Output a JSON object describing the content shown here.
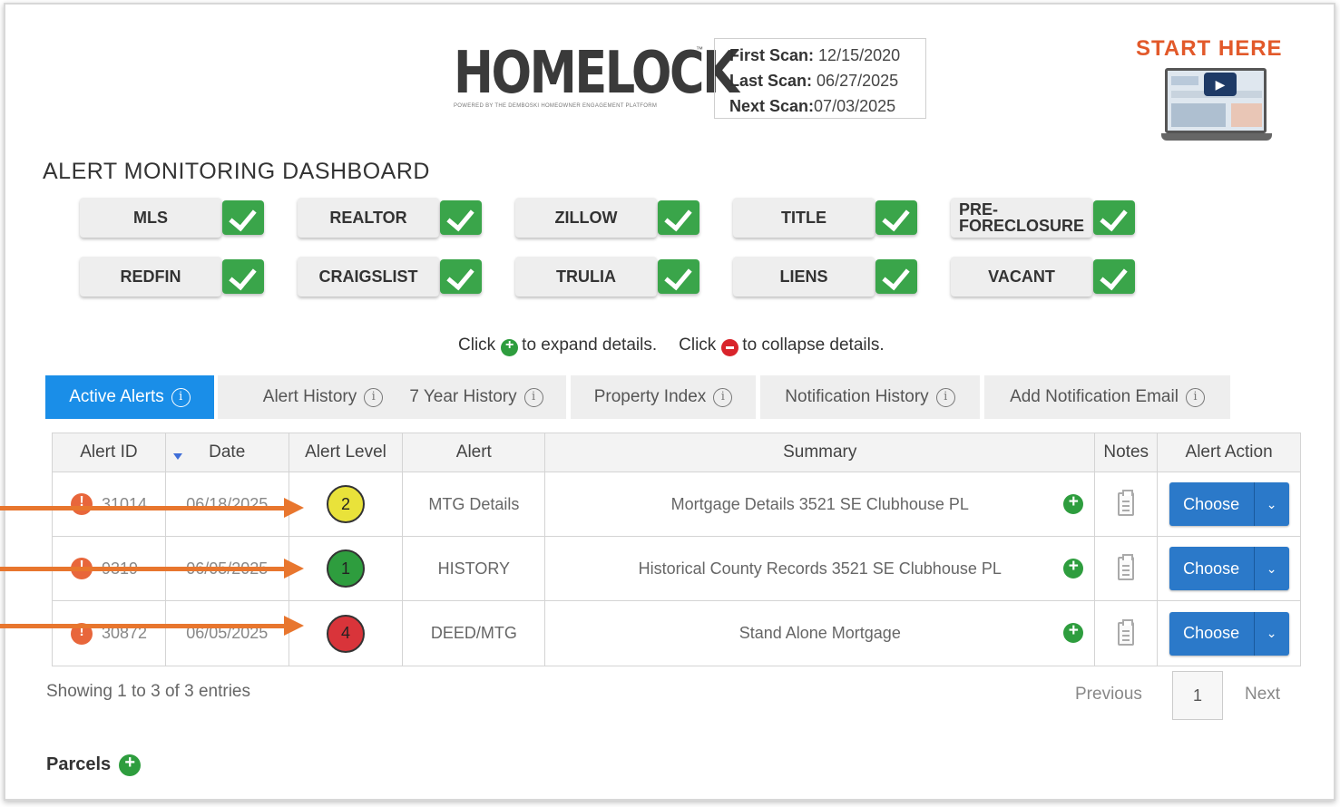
{
  "header": {
    "logo_text": "HOMELOCK",
    "logo_tagline": "POWERED BY THE DEMBOSKI HOMEOWNER ENGAGEMENT PLATFORM",
    "logo_tm": "™",
    "scan": {
      "first_label": "First Scan:",
      "first_value": "12/15/2020",
      "last_label": "Last Scan:",
      "last_value": "06/27/2025",
      "next_label": "Next Scan:",
      "next_value": "07/03/2025"
    },
    "start_here": "START HERE"
  },
  "dashboard_title": "ALERT MONITORING DASHBOARD",
  "sources": [
    {
      "label": "MLS",
      "checked": true
    },
    {
      "label": "REALTOR",
      "checked": true
    },
    {
      "label": "ZILLOW",
      "checked": true
    },
    {
      "label": "TITLE",
      "checked": true
    },
    {
      "label": "PRE-\nFORECLOSURE",
      "checked": true
    },
    {
      "label": "REDFIN",
      "checked": true
    },
    {
      "label": "CRAIGSLIST",
      "checked": true
    },
    {
      "label": "TRULIA",
      "checked": true
    },
    {
      "label": "LIENS",
      "checked": true
    },
    {
      "label": "VACANT",
      "checked": true
    }
  ],
  "hint": {
    "click1": "Click",
    "expand": "to expand details.",
    "click2": "Click",
    "collapse": "to collapse details."
  },
  "tabs": [
    {
      "label": "Active Alerts",
      "active": true
    },
    {
      "label": "Alert History",
      "active": false
    },
    {
      "label": "7 Year History",
      "active": false
    },
    {
      "label": "Property Index",
      "active": false
    },
    {
      "label": "Notification History",
      "active": false
    },
    {
      "label": "Add Notification Email",
      "active": false
    }
  ],
  "table": {
    "headers": [
      "Alert ID",
      "Date",
      "Alert Level",
      "Alert",
      "Summary",
      "Notes",
      "Alert Action"
    ],
    "rows": [
      {
        "id": "31014",
        "date": "06/18/2025",
        "level": "2",
        "level_color": "#e9e23a",
        "alert": "MTG Details",
        "summary": "Mortgage Details 3521 SE Clubhouse PL",
        "action": "Choose"
      },
      {
        "id": "9319",
        "date": "06/05/2025",
        "level": "1",
        "level_color": "#2e9d3e",
        "alert": "HISTORY",
        "summary": "Historical County Records 3521 SE Clubhouse PL",
        "action": "Choose"
      },
      {
        "id": "30872",
        "date": "06/05/2025",
        "level": "4",
        "level_color": "#d9343a",
        "alert": "DEED/MTG",
        "summary": "Stand Alone Mortgage",
        "action": "Choose"
      }
    ]
  },
  "footer": {
    "showing": "Showing 1 to 3 of 3 entries",
    "previous": "Previous",
    "page": "1",
    "next": "Next",
    "parcels": "Parcels"
  },
  "colors": {
    "accent_blue": "#1a8ee8",
    "check_green": "#3aa54a",
    "annotation_orange": "#e8762e",
    "start_here_orange": "#e2592a"
  }
}
